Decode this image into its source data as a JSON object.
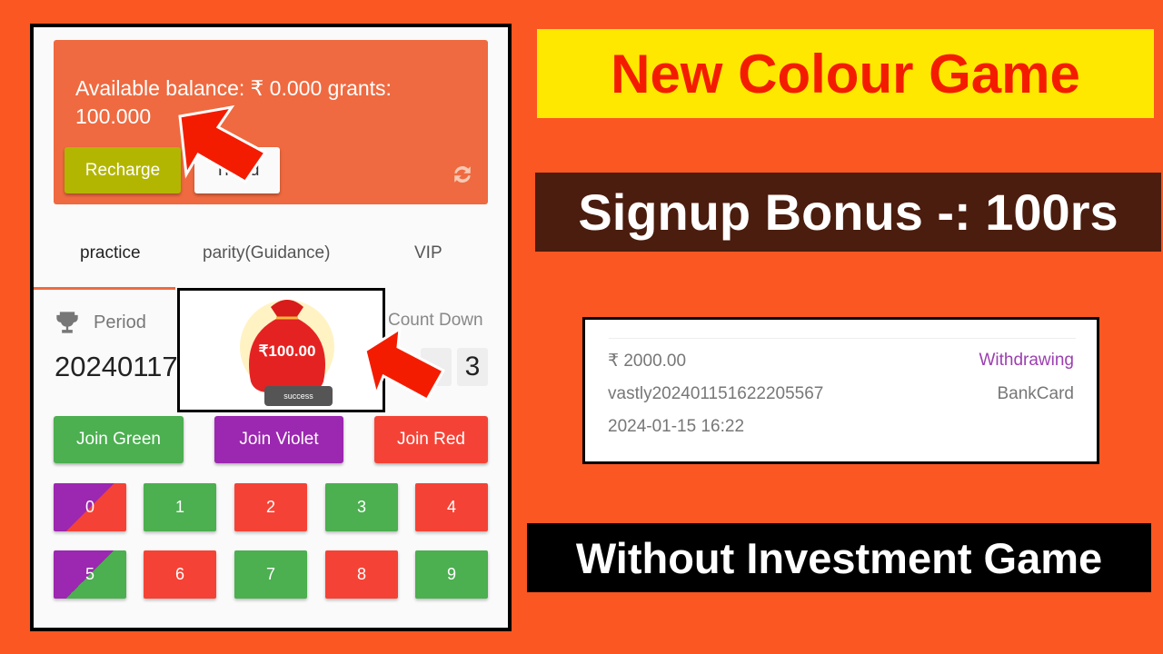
{
  "balance_card": {
    "text": "Available balance: ₹ 0.000 grants: 100.000",
    "recharge_label": "Recharge",
    "trend_label": "Trend"
  },
  "tabs": [
    "practice",
    "parity(Guidance)",
    "VIP"
  ],
  "period": {
    "label": "Period",
    "value": "20240117",
    "countdown_label": "Count Down",
    "countdown_digit": "3"
  },
  "popup": {
    "amount": "₹100.00",
    "status": "success"
  },
  "join_buttons": [
    "Join Green",
    "Join Violet",
    "Join Red"
  ],
  "numbers": [
    "0",
    "1",
    "2",
    "3",
    "4",
    "5",
    "6",
    "7",
    "8",
    "9"
  ],
  "colors": {
    "green": "#4caf50",
    "violet": "#9c27b0",
    "red": "#f44336",
    "accent": "#ef6a40",
    "background": "#fb5722"
  },
  "banners": {
    "title": "New Colour Game",
    "bonus": "Signup Bonus -: 100rs",
    "tagline": "Without Investment Game"
  },
  "withdrawal": {
    "amount": "₹ 2000.00",
    "status": "Withdrawing",
    "order_id": "vastly20240115162220556­7",
    "method": "BankCard",
    "datetime": "2024-01-15 16:22"
  }
}
